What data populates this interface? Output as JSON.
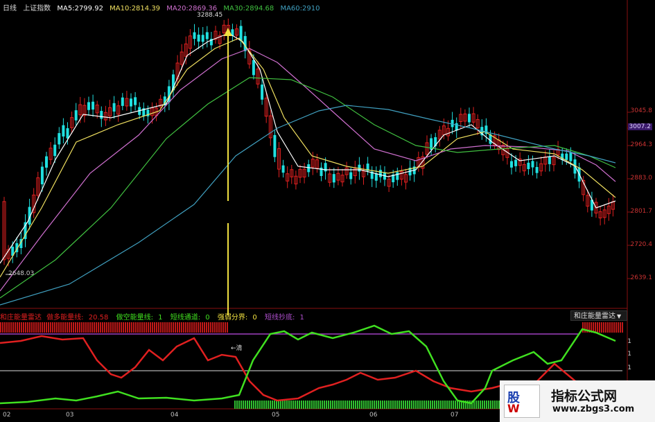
{
  "header": {
    "period": "日线",
    "index_name": "上证指数",
    "ma5_label": "MA5:",
    "ma5_value": "2799.92",
    "ma10_label": "MA10:",
    "ma10_value": "2814.39",
    "ma20_label": "MA20:",
    "ma20_value": "2869.36",
    "ma30_label": "MA30:",
    "ma30_value": "2894.68",
    "ma60_label": "MA60:",
    "ma60_value": "2910"
  },
  "annotations": {
    "high_price": "3288.45",
    "low_price": "2648.03",
    "signal_label": "←清"
  },
  "price_axis": [
    "3045.8",
    "3007.2",
    "2964.3",
    "2883.0",
    "2801.7",
    "2720.4",
    "2639.1"
  ],
  "price_axis_highlight": "3007.2",
  "indicator_header": {
    "name": "和庄能量雷达",
    "long_label": "做多能量线:",
    "long_value": "20.58",
    "short_label": "做空能量线:",
    "short_value": "1",
    "pass_label": "短线通道:",
    "pass_value": "0",
    "strength_label": "强弱分界:",
    "strength_value": "0",
    "bottom_label": "短线抄底:",
    "bottom_value": "1"
  },
  "indicator_dropdown": "和庄能量雷达",
  "indicator_axis": [
    "1",
    "1",
    "1"
  ],
  "date_axis": [
    "02",
    "03",
    "04",
    "05",
    "06",
    "07"
  ],
  "watermark": {
    "title": "指标公式网",
    "url": "www.zbgs3.com",
    "logo_top": "股",
    "logo_bottom": "W"
  },
  "colors": {
    "up": "#e02020",
    "down": "#20e0e0",
    "ma5": "#ffffff",
    "ma10": "#f0e060",
    "ma20": "#d070d0",
    "ma30": "#40c040",
    "ma60": "#40a0c0",
    "long_line": "#e02020",
    "short_line": "#40e020",
    "signal": "#f0e040",
    "boundary": "#a040c0"
  }
}
